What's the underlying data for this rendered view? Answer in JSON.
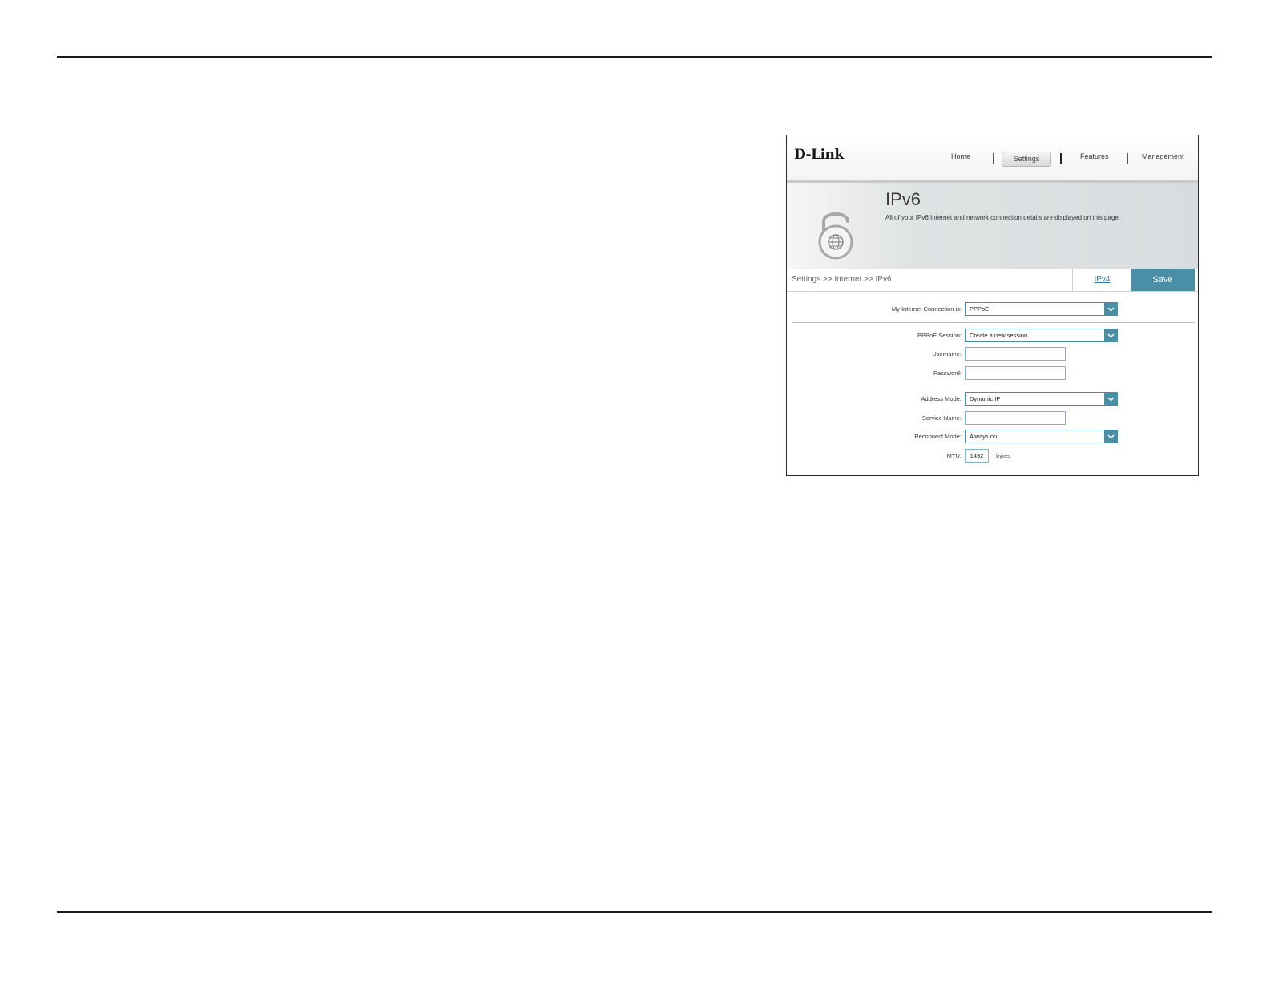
{
  "router_ui": {
    "brand": "D-Link",
    "nav": {
      "home": "Home",
      "settings": "Settings",
      "features": "Features",
      "management": "Management"
    },
    "banner": {
      "title": "IPv6",
      "description": "All of your IPv6 Internet and network connection details are displayed on this page."
    },
    "breadcrumb": "Settings >> Internet >> IPv6",
    "ipv4_link": "IPv4",
    "save_label": "Save",
    "form": {
      "connection_label": "My Internet Connection is:",
      "connection_value": "PPPoE",
      "session_label": "PPPoE Session:",
      "session_value": "Create a new session",
      "username_label": "Username:",
      "username_value": "",
      "password_label": "Password:",
      "password_value": "",
      "address_mode_label": "Address Mode:",
      "address_mode_value": "Dynamic IP",
      "service_name_label": "Service Name:",
      "service_name_value": "",
      "reconnect_label": "Reconnect Mode:",
      "reconnect_value": "Always on",
      "mtu_label": "MTU:",
      "mtu_value": "1492",
      "mtu_unit": "bytes"
    }
  },
  "colors": {
    "accent": "#4a8fa6",
    "link": "#2a7a9c"
  }
}
